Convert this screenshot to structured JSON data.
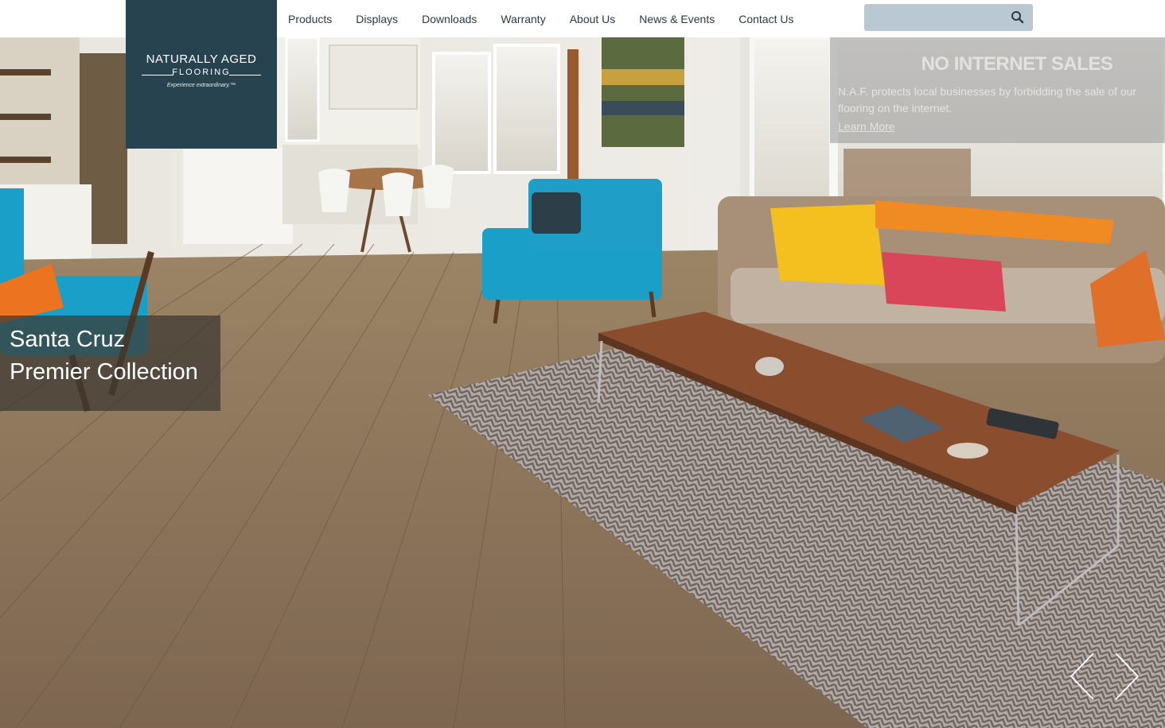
{
  "nav": {
    "items": [
      {
        "label": "Products"
      },
      {
        "label": "Displays"
      },
      {
        "label": "Downloads"
      },
      {
        "label": "Warranty"
      },
      {
        "label": "About Us"
      },
      {
        "label": "News & Events"
      },
      {
        "label": "Contact Us"
      }
    ]
  },
  "search": {
    "placeholder": "",
    "value": "",
    "icon": "search-icon"
  },
  "logo": {
    "line1": "NATURALLY AGED",
    "line2": "FLOORING",
    "tagline": "Experience extraordinary.™"
  },
  "notice": {
    "title": "NO INTERNET SALES",
    "body": "N.A.F. protects local businesses by forbidding the sale of our flooring on the internet.",
    "link": "Learn More"
  },
  "hero": {
    "caption_line1": "Santa Cruz",
    "caption_line2": "Premier Collection",
    "prev_icon": "chevron-left-icon",
    "next_icon": "chevron-right-icon"
  },
  "colors": {
    "brand": "#284350",
    "nav_text": "#2b3a44",
    "search_bg": "#b9c8d2"
  }
}
